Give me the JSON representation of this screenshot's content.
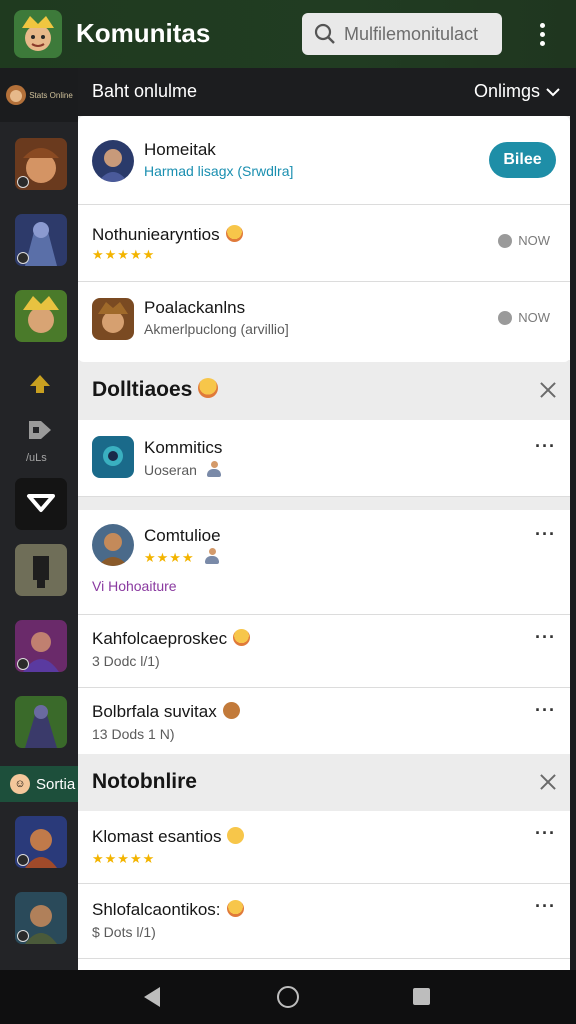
{
  "app": {
    "title": "Komunitas",
    "search_placeholder": "Mulfilemonitulact",
    "icons": [
      "app-logo-icon",
      "search-icon",
      "more-vert-icon"
    ]
  },
  "subheader": {
    "left": "Baht onlulme",
    "right": "Onlimgs"
  },
  "rail": {
    "header_text": "Stats Online",
    "caption": "/uLs",
    "active_label": "Sortia"
  },
  "featured": {
    "title": "Homeitak",
    "subtitle": "Harmad lisagx (Srwdlra]",
    "button": "Bilee"
  },
  "list_top": [
    {
      "title": "Nothuniearyntios",
      "status": "NOW"
    },
    {
      "title": "Poalackanlns",
      "subtitle": "Akmerlpuclong (arvillio]",
      "status": "NOW"
    }
  ],
  "section1": {
    "title": "Dolltiaoes",
    "items": [
      {
        "title": "Kommitics",
        "subtitle": "Uoseran"
      },
      {
        "title": "Comtulioe",
        "tag": "Vi Hohoaiture"
      },
      {
        "title": "Kahfolcaeproskec",
        "subtitle": "3 Dodc l/1)"
      },
      {
        "title": "Bolbrfala suvitax",
        "subtitle": "13 Dods 1 N)"
      }
    ]
  },
  "section2": {
    "title": "Notobnlire",
    "items": [
      {
        "title": "Klomast esantios"
      },
      {
        "title": "Shlofalcaontikos:",
        "subtitle": "$ Dots l/1)"
      }
    ]
  },
  "colors": {
    "appbar": "#213c22",
    "accent": "#1e8ea7",
    "star": "#f3b400",
    "rail_active": "#1d4f3b"
  }
}
